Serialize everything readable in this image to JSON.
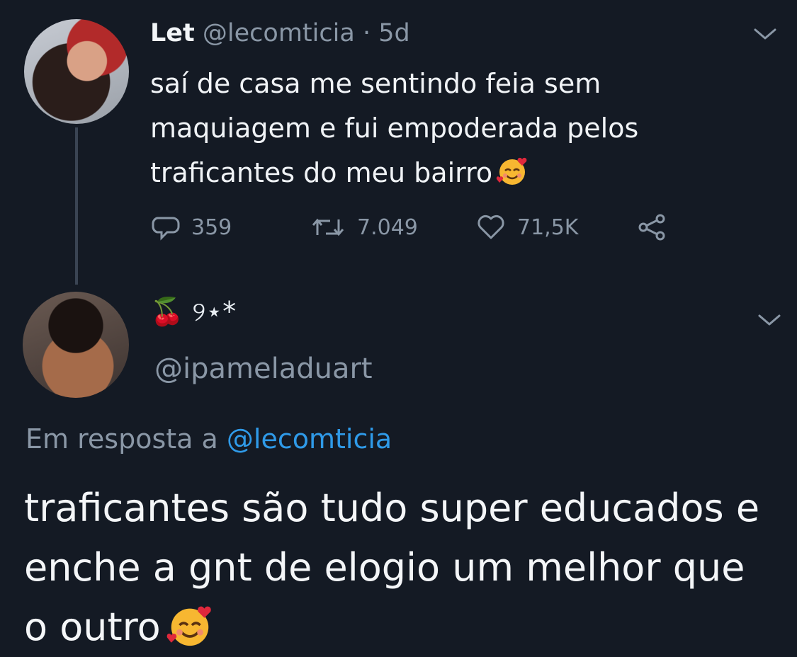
{
  "tweet1": {
    "name": "Let",
    "handle": "@lecomticia",
    "separator": "·",
    "time": "5d",
    "text": "saí de casa me sentindo feia sem maquiagem e fui empoderada pelos traficantes do meu bairro",
    "emoji_icon": "smiling-face-with-hearts-emoji",
    "actions": {
      "replies": "359",
      "retweets": "7.049",
      "likes": "71,5K"
    }
  },
  "tweet2": {
    "name_symbols": "🍒 ୨⋆*",
    "handle": "@ipameladuart",
    "reply_prefix": "Em resposta a",
    "reply_to": "@lecomticia",
    "text": "traficantes são tudo super educados e enche a gnt de elogio um melhor que o outro",
    "emoji_icon": "smiling-face-with-hearts-emoji"
  },
  "colors": {
    "background": "#141a24",
    "muted": "#8a97a6",
    "link": "#2f9ae8"
  }
}
